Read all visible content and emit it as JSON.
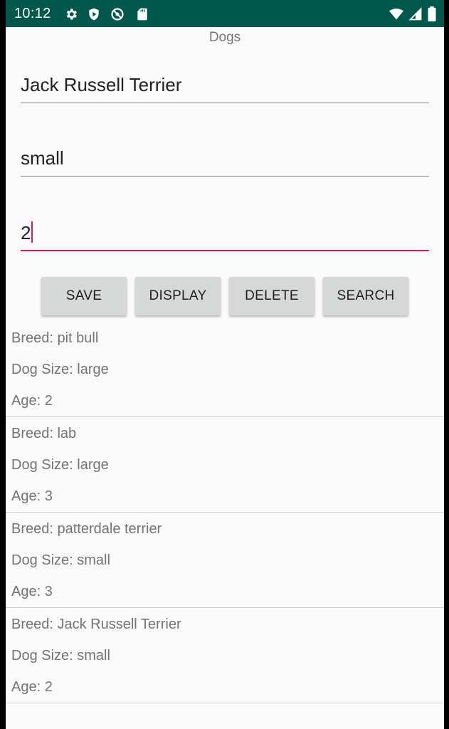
{
  "status_bar": {
    "time": "10:12",
    "icons": [
      "gear-icon",
      "shield-play-icon",
      "blocked-circle-icon",
      "sd-card-icon",
      "wifi-icon",
      "signal-icon",
      "battery-icon"
    ]
  },
  "app": {
    "title": "Dogs"
  },
  "form": {
    "breed_value": "Jack Russell Terrier",
    "size_value": "small",
    "age_value": "2"
  },
  "buttons": {
    "save": "SAVE",
    "display": "DISPLAY",
    "delete": "DELETE",
    "search": "SEARCH"
  },
  "dogs": [
    {
      "breed": "Breed: pit bull",
      "size": "Dog Size: large",
      "age": "Age: 2"
    },
    {
      "breed": "Breed: lab",
      "size": "Dog Size: large",
      "age": "Age: 3"
    },
    {
      "breed": "Breed: patterdale terrier",
      "size": "Dog Size: small",
      "age": "Age: 3"
    },
    {
      "breed": "Breed: Jack Russell Terrier",
      "size": "Dog Size: small",
      "age": "Age: 2"
    }
  ],
  "colors": {
    "status_bar": "#00574b",
    "accent": "#d81b60",
    "background": "#fafafa",
    "button": "#d6d7d7"
  }
}
